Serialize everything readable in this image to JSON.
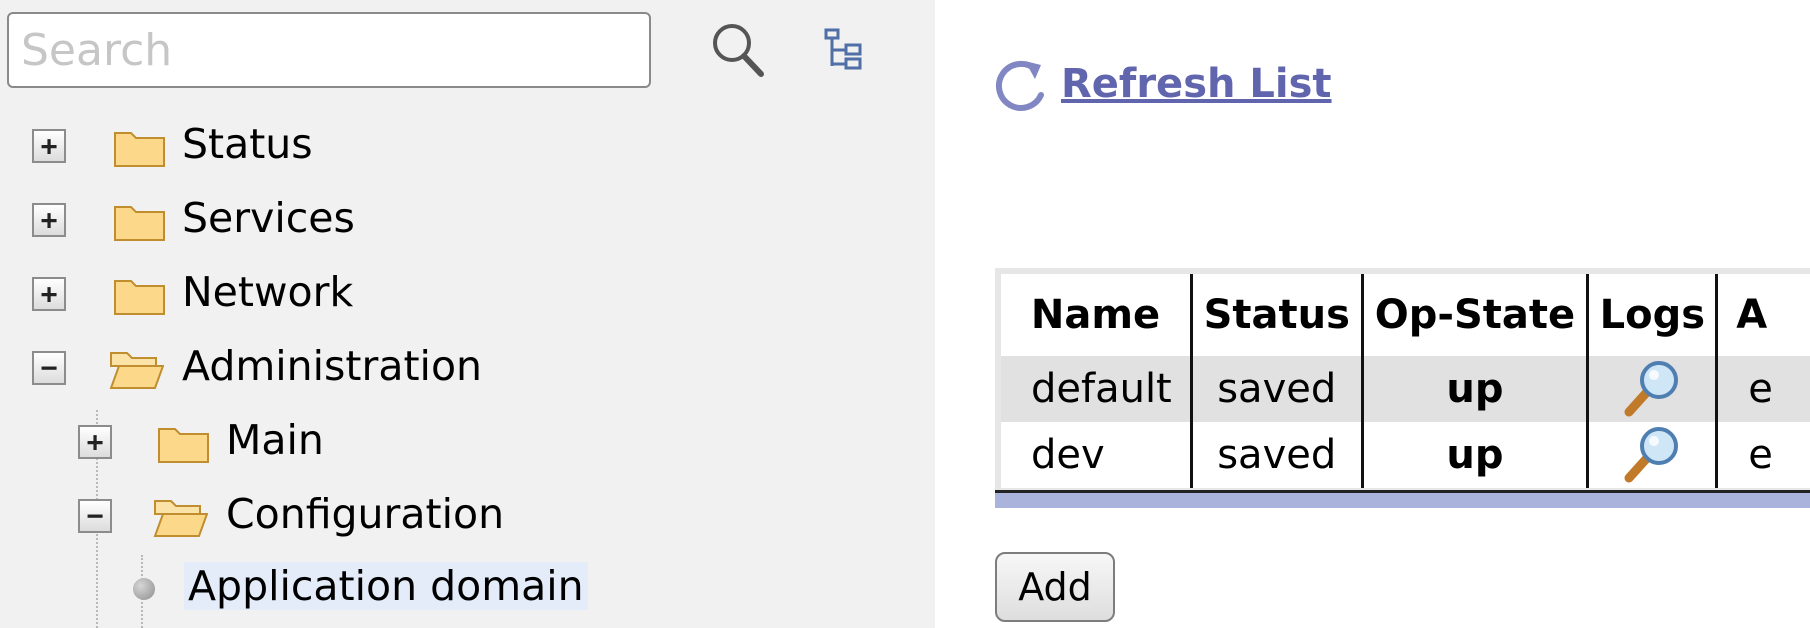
{
  "search": {
    "placeholder": "Search",
    "value": ""
  },
  "nav": {
    "items": [
      {
        "label": "Status",
        "expanded": false
      },
      {
        "label": "Services",
        "expanded": false
      },
      {
        "label": "Network",
        "expanded": false
      },
      {
        "label": "Administration",
        "expanded": true
      },
      {
        "label": "Main",
        "expanded": false
      },
      {
        "label": "Configuration",
        "expanded": true
      },
      {
        "label": "Application domain",
        "selected": true
      }
    ],
    "toggle_collapsed": "+",
    "toggle_expanded": "−"
  },
  "actions": {
    "refresh_label": "Refresh List",
    "add_label": "Add"
  },
  "table": {
    "headers": [
      "Name",
      "Status",
      "Op-State",
      "Logs",
      "A"
    ],
    "rows": [
      {
        "name": "default",
        "status": "saved",
        "op_state": "up",
        "extra": "e"
      },
      {
        "name": "dev",
        "status": "saved",
        "op_state": "up",
        "extra": "e"
      }
    ]
  },
  "colors": {
    "link": "#6065ad",
    "table_footer": "#aab3dc",
    "panel_bg": "#f1f1f1",
    "selected_bg": "#e3ecf8"
  },
  "icons": [
    "search-icon",
    "tree-view-icon",
    "folder-icon",
    "folder-open-icon",
    "refresh-icon",
    "magnifier-icon"
  ]
}
